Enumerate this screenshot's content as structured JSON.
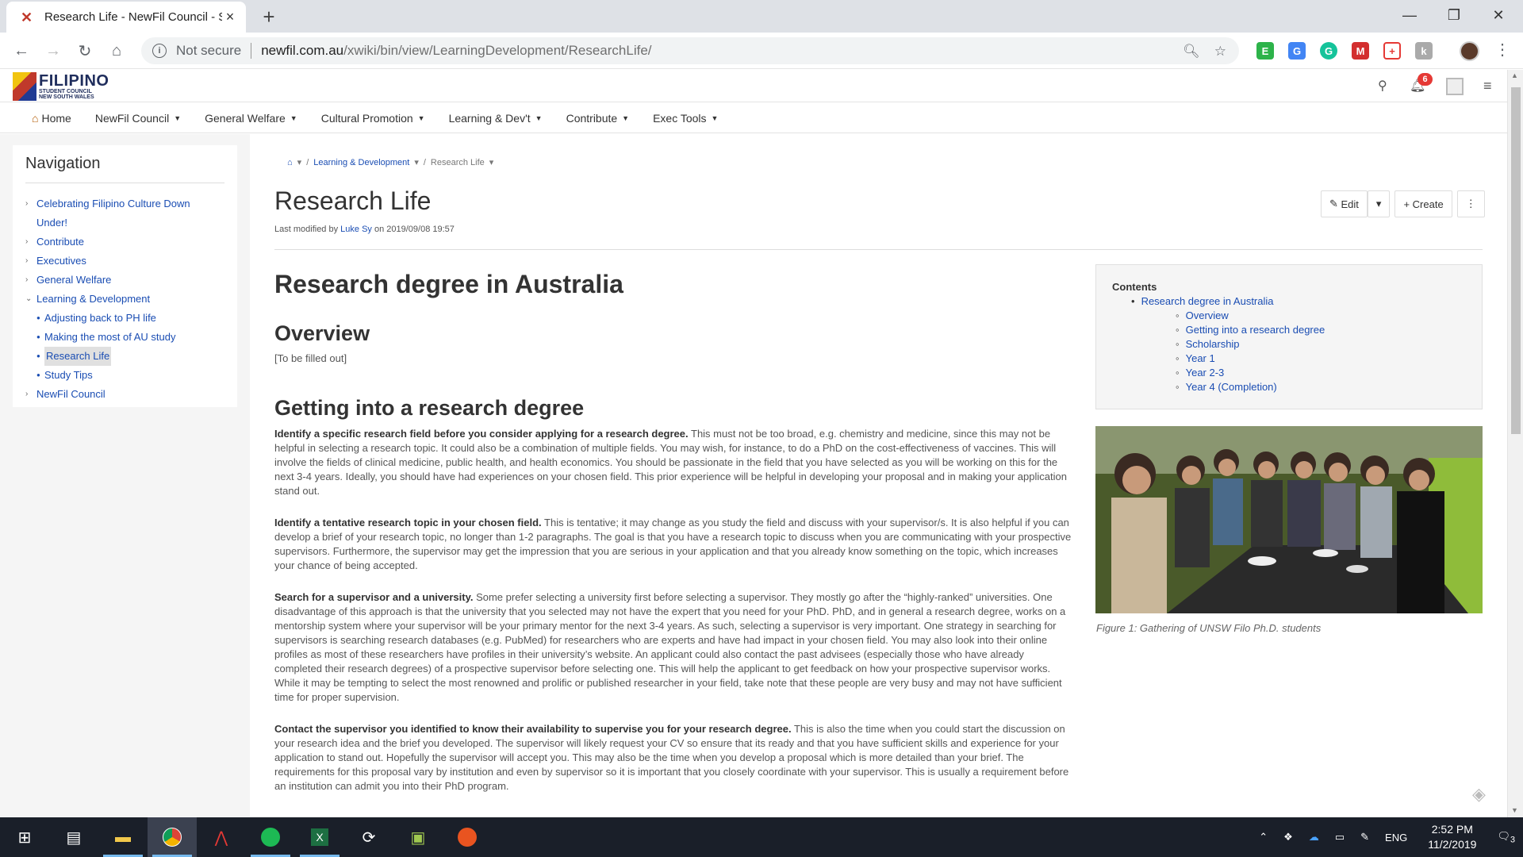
{
  "browser": {
    "tab_title": "Research Life - NewFil Council - S",
    "new_tab": "+",
    "omnibox": {
      "security_label": "Not secure",
      "url_host": "newfil.com.au",
      "url_path": "/xwiki/bin/view/LearningDevelopment/ResearchLife/"
    }
  },
  "site": {
    "logo": {
      "big": "FILIPINO",
      "line2": "STUDENT COUNCIL",
      "line3": "NEW SOUTH WALES"
    },
    "notification_count": "6",
    "menu": [
      {
        "label": "Home"
      },
      {
        "label": "NewFil Council"
      },
      {
        "label": "General Welfare"
      },
      {
        "label": "Cultural Promotion"
      },
      {
        "label": "Learning & Dev't"
      },
      {
        "label": "Contribute"
      },
      {
        "label": "Exec Tools"
      }
    ]
  },
  "sidebar": {
    "title": "Navigation",
    "items": [
      {
        "label": "Celebrating Filipino Culture Down",
        "label2": "Under!"
      },
      {
        "label": "Contribute"
      },
      {
        "label": "Executives"
      },
      {
        "label": "General Welfare"
      },
      {
        "label": "Learning & Development"
      },
      {
        "label": "NewFil Council"
      }
    ],
    "subitems": [
      {
        "label": "Adjusting back to PH life"
      },
      {
        "label": "Making the most of AU study"
      },
      {
        "label": "Research Life"
      },
      {
        "label": "Study Tips"
      }
    ]
  },
  "breadcrumb": {
    "section": "Learning & Development",
    "current": "Research Life"
  },
  "page": {
    "title": "Research Life",
    "meta_prefix": "Last modified by",
    "author": "Luke Sy",
    "meta_suffix": "on 2019/09/08 19:57",
    "edit_label": "Edit",
    "create_label": "Create"
  },
  "content": {
    "h1": "Research degree in Australia",
    "overview_title": "Overview",
    "overview_text": "[To be filled out]",
    "getting_title": "Getting into a research degree",
    "paragraphs": [
      {
        "bold": "Identify a specific research field before you consider applying for a research degree.",
        "text": " This must not be too broad, e.g. chemistry and medicine, since this may not be helpful in selecting a research topic. It could also be a combination of multiple fields. You may wish, for instance, to do a PhD on the cost-effectiveness of vaccines. This will involve the fields of clinical medicine, public health, and health economics. You should be passionate in the field that you have selected as you will be working on this for the next 3-4 years. Ideally, you should have had experiences on your chosen field. This prior experience will be helpful in developing your proposal and in making your application stand out."
      },
      {
        "bold": "Identify a tentative research topic in your chosen field.",
        "text": " This is tentative; it may change as you study the field and discuss with your supervisor/s. It is also helpful if you can develop a brief of your research topic, no longer than 1-2 paragraphs. The goal is that you have a research topic to discuss when you are communicating with your prospective supervisors. Furthermore, the supervisor may get the impression that you are serious in your application and that you already know something on the topic, which increases your chance of being accepted."
      },
      {
        "bold": "Search for a supervisor and a university.",
        "text": " Some prefer selecting a university first before selecting a supervisor. They mostly go after the “highly-ranked” universities. One disadvantage of this approach is that the university that you selected may not have the expert that you need for your PhD. PhD, and in general a research degree, works on a mentorship system where your supervisor will be your primary mentor for the next 3-4 years. As such, selecting a supervisor is very important. One strategy in searching for supervisors is searching research databases (e.g. PubMed) for researchers who are experts and have had impact in your chosen field. You may also look into their online profiles as most of these researchers have profiles in their university’s website. An applicant could also contact the past advisees (especially those who have already completed their research degrees) of a prospective supervisor before selecting one. This will help the applicant to get feedback on how your prospective supervisor works. While it may be tempting to select the most renowned and prolific or published researcher in your field, take note that these people are very busy and may not have sufficient time for proper supervision."
      },
      {
        "bold": "Contact the supervisor you identified to know their availability to supervise you for your research degree.",
        "text": " This is also the time when you could start the discussion on your research idea and the brief you developed. The supervisor will likely request your CV so ensure that its ready and that you have sufficient skills and experience for your application to stand out. Hopefully the supervisor will accept you. This may also be the time when you develop a proposal which is more detailed than your brief. The requirements for this proposal vary by institution and even by supervisor so it is important that you closely coordinate with your supervisor. This is usually a requirement before an institution can admit you into their PhD program."
      }
    ]
  },
  "toc": {
    "title": "Contents",
    "top": "Research degree in Australia",
    "items": [
      "Overview",
      "Getting into a research degree",
      "Scholarship",
      "Year 1",
      "Year 2-3",
      "Year 4 (Completion)"
    ]
  },
  "figure": {
    "caption": "Figure 1: Gathering of UNSW Filo Ph.D. students"
  },
  "taskbar": {
    "lang": "ENG",
    "time": "2:52 PM",
    "date": "11/2/2019",
    "notif_count": "3"
  }
}
